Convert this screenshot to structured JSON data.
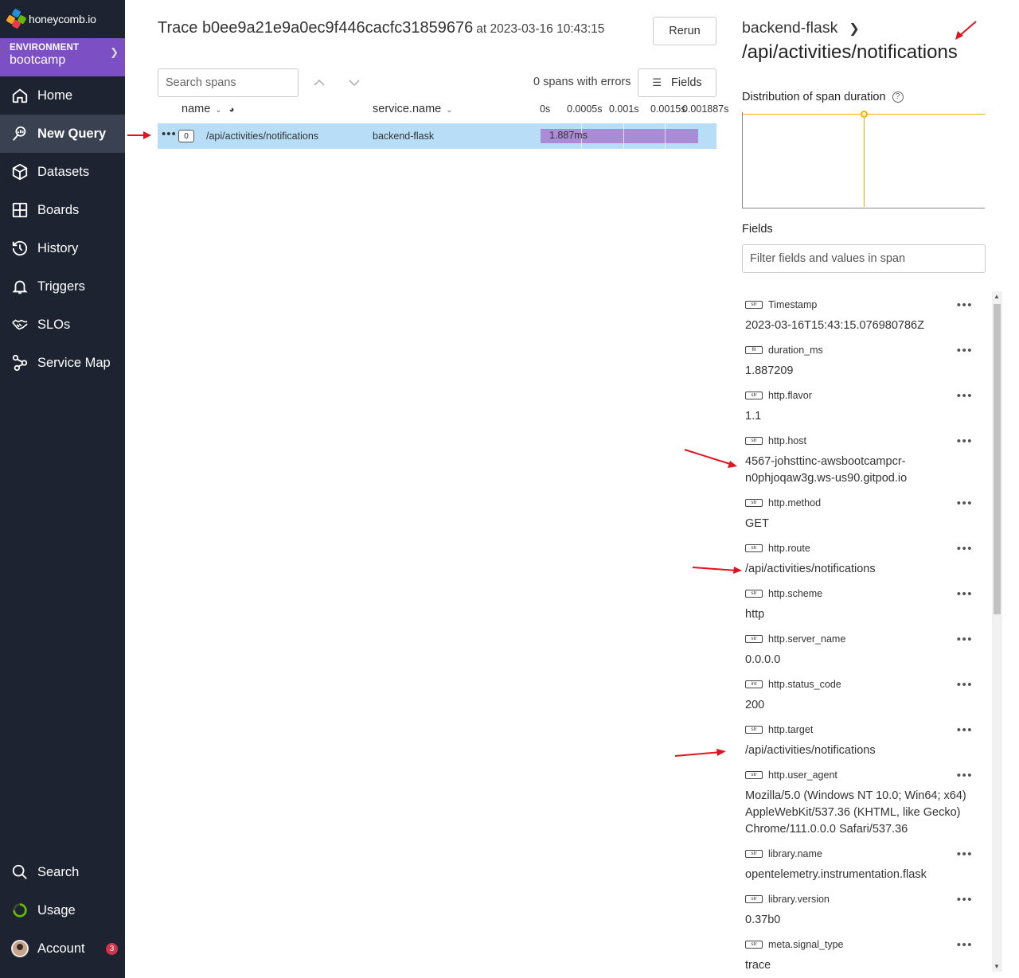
{
  "brand": {
    "logo_text": "honeycomb.io"
  },
  "environment": {
    "label": "ENVIRONMENT",
    "name": "bootcamp"
  },
  "nav": {
    "items": [
      {
        "label": "Home",
        "icon": "home-icon"
      },
      {
        "label": "New Query",
        "icon": "query-icon",
        "active": true
      },
      {
        "label": "Datasets",
        "icon": "cube-icon"
      },
      {
        "label": "Boards",
        "icon": "boards-icon"
      },
      {
        "label": "History",
        "icon": "history-icon"
      },
      {
        "label": "Triggers",
        "icon": "bell-icon"
      },
      {
        "label": "SLOs",
        "icon": "handshake-icon"
      },
      {
        "label": "Service Map",
        "icon": "service-map-icon"
      }
    ],
    "bottom": [
      {
        "label": "Search",
        "icon": "search-icon"
      },
      {
        "label": "Usage",
        "icon": "usage-icon"
      },
      {
        "label": "Account",
        "icon": "avatar",
        "badge": "3"
      }
    ]
  },
  "trace": {
    "title": "Trace b0ee9a21e9a0ec9f446cacfc31859676",
    "at": "at 2023-03-16 10:43:15",
    "rerun_label": "Rerun",
    "search_placeholder": "Search spans",
    "errors_text": "0 spans with errors",
    "fields_label": "Fields",
    "columns": {
      "name": "name",
      "service": "service.name"
    },
    "ticks": [
      "0s",
      "0.0005s",
      "0.001s",
      "0.0015s",
      "0.001887s"
    ],
    "span": {
      "count": "0",
      "name": "/api/activities/notifications",
      "service": "backend-flask",
      "duration_label": "1.887ms",
      "duration_fraction": 1.0
    }
  },
  "panel": {
    "service": "backend-flask",
    "title": "/api/activities/notifications",
    "dist_title": "Distribution of span duration",
    "fields_title": "Fields",
    "filter_placeholder": "Filter fields and values in span",
    "fields": [
      {
        "type": "str",
        "name": "Timestamp",
        "value": "2023-03-16T15:43:15.076980786Z"
      },
      {
        "type": "flt",
        "name": "duration_ms",
        "value": "1.887209"
      },
      {
        "type": "str",
        "name": "http.flavor",
        "value": "1.1"
      },
      {
        "type": "str",
        "name": "http.host",
        "value": "4567-johsttinc-awsbootcampcr-n0phjoqaw3g.ws-us90.gitpod.io"
      },
      {
        "type": "str",
        "name": "http.method",
        "value": "GET"
      },
      {
        "type": "str",
        "name": "http.route",
        "value": "/api/activities/notifications"
      },
      {
        "type": "str",
        "name": "http.scheme",
        "value": "http"
      },
      {
        "type": "str",
        "name": "http.server_name",
        "value": "0.0.0.0"
      },
      {
        "type": "int",
        "name": "http.status_code",
        "value": "200"
      },
      {
        "type": "str",
        "name": "http.target",
        "value": "/api/activities/notifications"
      },
      {
        "type": "str",
        "name": "http.user_agent",
        "value": "Mozilla/5.0 (Windows NT 10.0; Win64; x64) AppleWebKit/537.36 (KHTML, like Gecko) Chrome/111.0.0.0 Safari/537.36"
      },
      {
        "type": "str",
        "name": "library.name",
        "value": "opentelemetry.instrumentation.flask"
      },
      {
        "type": "str",
        "name": "library.version",
        "value": "0.37b0"
      },
      {
        "type": "str",
        "name": "meta.signal_type",
        "value": "trace"
      }
    ]
  },
  "colors": {
    "sidebar_bg": "#1d2330",
    "environment_bg": "#7c4fc4",
    "selected_row": "#b8def7",
    "span_bar": "#a98bd6",
    "distribution_line": "#f2b300",
    "annotation_arrow": "#e0141e"
  }
}
